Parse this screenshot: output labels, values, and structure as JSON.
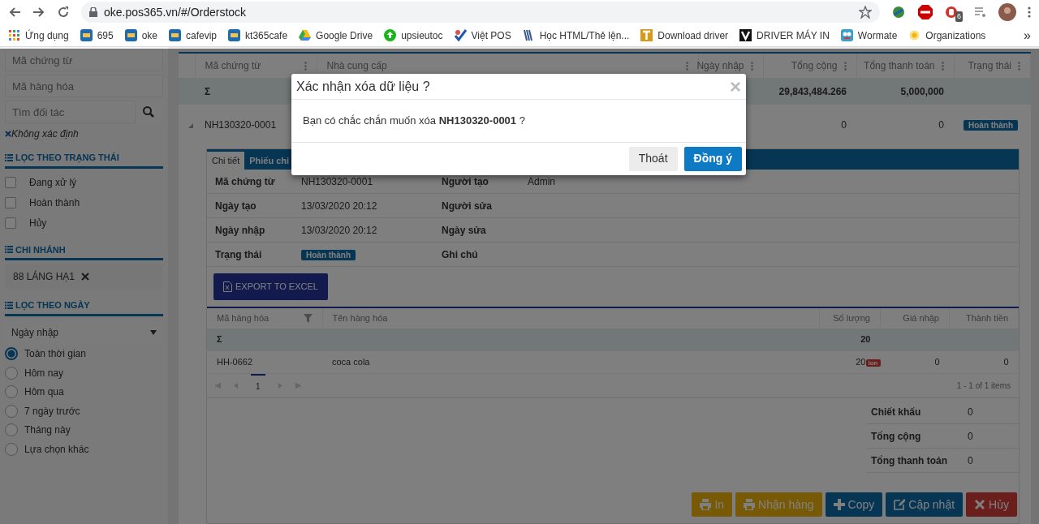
{
  "browser": {
    "url": "oke.pos365.vn/#/Orderstock",
    "extension_badge": "6",
    "bookmarks": [
      {
        "label": "Ứng dụng",
        "kind": "apps"
      },
      {
        "label": "695",
        "kind": "pos"
      },
      {
        "label": "oke",
        "kind": "pos"
      },
      {
        "label": "cafevip",
        "kind": "pos"
      },
      {
        "label": "kt365cafe",
        "kind": "pos"
      },
      {
        "label": "Google Drive",
        "kind": "drive"
      },
      {
        "label": "upsieutoc",
        "kind": "up"
      },
      {
        "label": "Việt POS",
        "kind": "check"
      },
      {
        "label": "Học HTML/Thẻ lện...",
        "kind": "books"
      },
      {
        "label": "Download driver",
        "kind": "t"
      },
      {
        "label": "DRIVER MÁY IN",
        "kind": "v"
      },
      {
        "label": "Wormate",
        "kind": "worm"
      },
      {
        "label": "Organizations",
        "kind": "org"
      }
    ],
    "more": "»"
  },
  "sidebar": {
    "fields": [
      {
        "placeholder": "Mã chứng từ"
      },
      {
        "placeholder": "Mã hàng hóa"
      },
      {
        "placeholder": "Tìm đối tác"
      }
    ],
    "partner_tag": "Không xác định",
    "status_filter": {
      "title": "LỌC THEO TRẠNG THÁI",
      "items": [
        {
          "label": "Đang xử lý",
          "checked": false
        },
        {
          "label": "Hoàn thành",
          "checked": false
        },
        {
          "label": "Hủy",
          "checked": false
        }
      ]
    },
    "branch": {
      "title": "CHI NHÁNH",
      "tag": "88 LÁNG HẠ1"
    },
    "date_filter": {
      "title": "LỌC THEO NGÀY",
      "select": "Ngày nhập",
      "options": [
        {
          "label": "Toàn thời gian",
          "selected": true
        },
        {
          "label": "Hôm nay",
          "selected": false
        },
        {
          "label": "Hôm qua",
          "selected": false
        },
        {
          "label": "7 ngày trước",
          "selected": false
        },
        {
          "label": "Tháng này",
          "selected": false
        },
        {
          "label": "Lựa chọn khác",
          "selected": false
        }
      ]
    }
  },
  "table": {
    "columns": [
      "Mã chứng từ",
      "Nhà cung cấp",
      "Ngày nhập",
      "Tổng cộng",
      "Tổng thanh toán",
      "Trạng thái"
    ],
    "sum_row": {
      "symbol": "Σ",
      "total": "29,843,484.266",
      "paid": "5,000,000"
    },
    "rows": [
      {
        "code": "NH130320-0001",
        "total": "0",
        "paid": "0",
        "status": "Hoàn thành",
        "expanded": true
      }
    ]
  },
  "detail": {
    "tabs": [
      {
        "label": "Chi tiết",
        "selected": true
      },
      {
        "label": "Phiếu chi",
        "selected": false
      }
    ],
    "info": [
      {
        "label": "Mã chứng từ",
        "value": "NH130320-0001",
        "label_2": "Người tạo",
        "value_2": "Admin"
      },
      {
        "label": "Ngày tạo",
        "value": "13/03/2020 20:12",
        "label_2": "Người sửa"
      },
      {
        "label": "Ngày nhập",
        "value": "13/03/2020 20:12",
        "label_2": "Ngày sửa"
      },
      {
        "label": "Trạng thái",
        "badge": "Hoàn thành",
        "label_2": "Ghi chú"
      }
    ],
    "export_button": "EXPORT TO EXCEL",
    "items": {
      "columns": [
        "Mã hàng hóa",
        "Tên hàng hóa",
        "Số lượng",
        "Giá nhập",
        "Thành tiền"
      ],
      "sum_row": {
        "symbol": "Σ",
        "quantity": "20"
      },
      "rows": [
        {
          "code": "HH-0662",
          "name": "coca cola",
          "quantity": "20",
          "unit": "lon",
          "price": "0",
          "amount": "0"
        }
      ],
      "page": "1",
      "pager_info": "1 - 1 of 1 items"
    },
    "totals": [
      {
        "label": "Chiết khấu",
        "value": "0"
      },
      {
        "label": "Tổng cộng",
        "value": "0"
      },
      {
        "label": "Tổng thanh toán",
        "value": "0"
      }
    ],
    "actions": [
      {
        "label": "In",
        "kind": "print"
      },
      {
        "label": "Nhận hàng",
        "kind": "print"
      },
      {
        "label": "Copy",
        "kind": "copy"
      },
      {
        "label": "Cập nhật",
        "kind": "update"
      },
      {
        "label": "Hủy",
        "kind": "cancel"
      }
    ]
  },
  "modal": {
    "title": "Xác nhận xóa dữ liệu ?",
    "close": "×",
    "message": "Bạn có chắc chắn muốn xóa **NH130320-0001** ?",
    "buttons": [
      {
        "label": "Thoát",
        "kind": "secondary"
      },
      {
        "label": "Đồng ý",
        "kind": "primary"
      }
    ]
  }
}
